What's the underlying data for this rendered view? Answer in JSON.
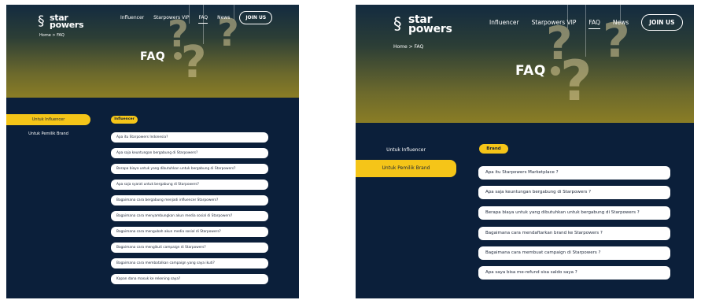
{
  "screenshot_left": {
    "logo": {
      "icon": "swirl-logo-icon",
      "line1": "star",
      "line2": "powers"
    },
    "nav": {
      "influencer": "Influencer",
      "vip": "Starpowers VIP",
      "faq": "FAQ",
      "news": "News",
      "join": "JOIN US"
    },
    "breadcrumb": "Home > FAQ",
    "title": "FAQ",
    "sidebar": {
      "tab_influencer": "Untuk Influencer",
      "tab_brand": "Untuk Pemilik Brand",
      "active": "influencer"
    },
    "category_pill": "Influencer",
    "questions": [
      "Apa itu Starpowers Indonesia?",
      "Apa saja keuntungan bergabung di Starpowers?",
      "Berapa biaya untuk yang dibutuhkan untuk bergabung di Starpowers?",
      "Apa saja syarat untuk bergabung di Starpowers?",
      "Bagaimana cara bergabung menjadi influencer Starpowers?",
      "Bagaimana cara menyambungkan akun media sosial di Starpowers?",
      "Bagaimana cara mengubah akun media sosial di Starpowers?",
      "Bagaimana cara mengikuti campaign di Starpowers?",
      "Bagaimana cara membatalkan campaign yang saya ikuti?",
      "Kapan dana masuk ke rekening saya?"
    ]
  },
  "screenshot_right": {
    "logo": {
      "icon": "swirl-logo-icon",
      "line1": "star",
      "line2": "powers"
    },
    "nav": {
      "influencer": "Influencer",
      "vip": "Starpowers VIP",
      "faq": "FAQ",
      "news": "News",
      "join": "JOIN US"
    },
    "breadcrumb": "Home > FAQ",
    "title": "FAQ",
    "sidebar": {
      "tab_influencer": "Untuk Influencer",
      "tab_brand": "Untuk Pemilik Brand",
      "active": "brand"
    },
    "category_pill": "Brand",
    "questions": [
      "Apa itu Starpowers Marketplace ?",
      "Apa saja keuntungan bergabung di Starpowers ?",
      "Berapa biaya untuk yang dibutuhkan untuk bergabung di Starpowers ?",
      "Bagaimana cara mendaftarkan brand ke Starpowers ?",
      "Bagaimana cara membuat campaign di Starpowers ?",
      "Apa saya bisa me-refund sisa saldo saya ?"
    ]
  },
  "colors": {
    "navy": "#0b1f3a",
    "accent_yellow": "#f5c518",
    "hero_gold": "#8a7d25",
    "card_white": "#ffffff"
  }
}
